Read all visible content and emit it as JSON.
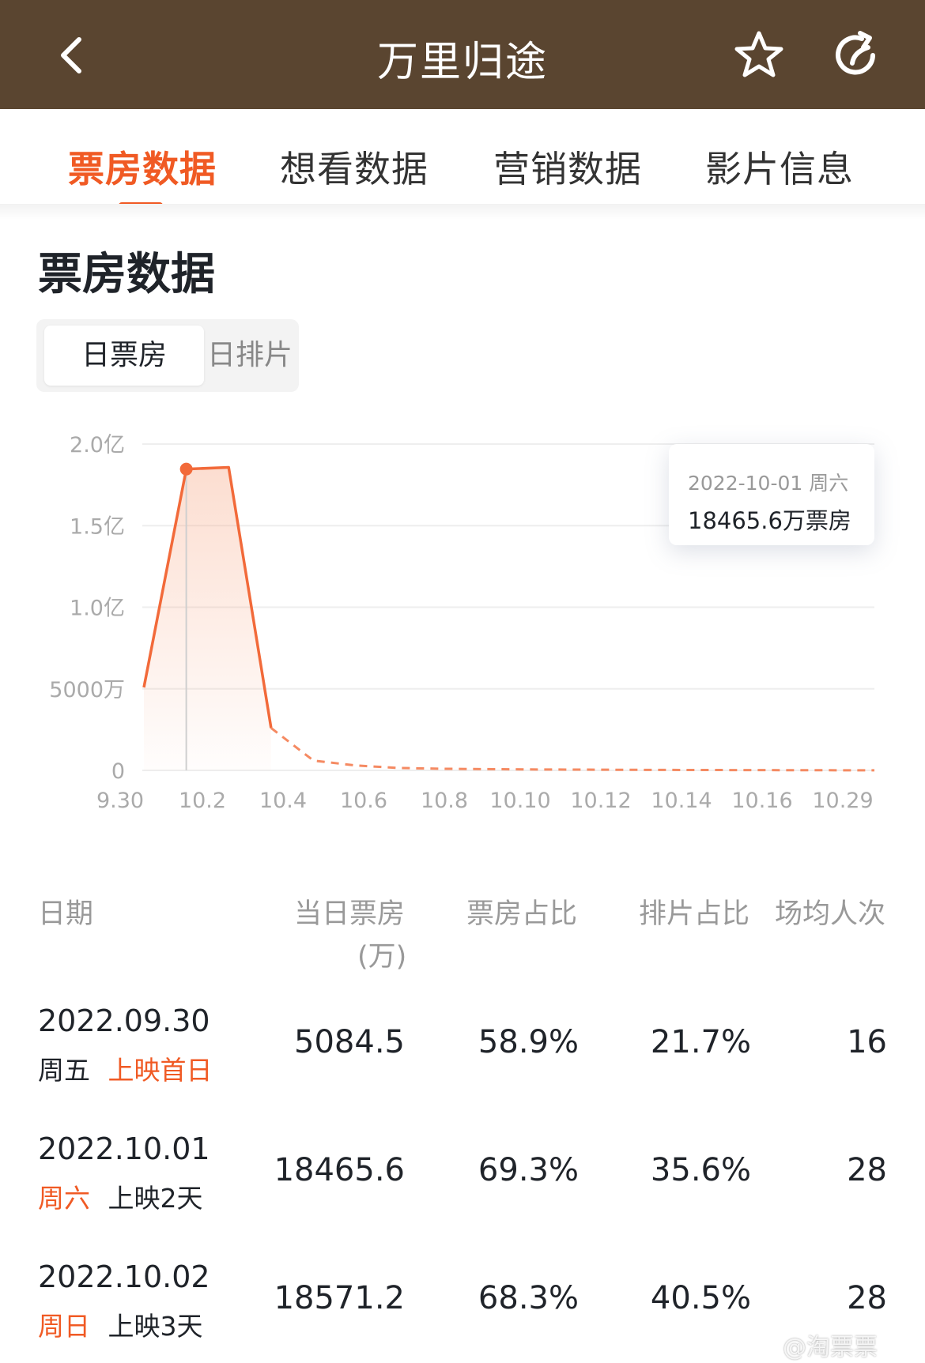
{
  "header": {
    "title": "万里归途",
    "back_icon": "back-icon",
    "favorite_icon": "star-icon",
    "share_icon": "share-icon",
    "color": "#5a4530"
  },
  "tabs": [
    {
      "label": "票房数据",
      "active": true
    },
    {
      "label": "想看数据",
      "active": false
    },
    {
      "label": "营销数据",
      "active": false
    },
    {
      "label": "影片信息",
      "active": false
    }
  ],
  "accent": "#f05a24",
  "section": {
    "title": "票房数据",
    "segments": [
      {
        "label": "日票房",
        "active": true
      },
      {
        "label": "日排片",
        "active": false
      }
    ]
  },
  "chart_data": {
    "type": "area",
    "y_tick_labels": [
      "2.0亿",
      "1.5亿",
      "1.0亿",
      "5000万",
      "0"
    ],
    "ylim": [
      0,
      20000
    ],
    "y_unit": "万",
    "x_tick_labels": [
      "9.30",
      "10.2",
      "10.4",
      "10.6",
      "10.8",
      "10.10",
      "10.12",
      "10.14",
      "10.16",
      "10.29"
    ],
    "x": [
      "9.30",
      "10.1",
      "10.2",
      "10.3",
      "10.4",
      "10.5",
      "10.6",
      "10.7",
      "10.8",
      "10.9",
      "10.10",
      "10.11",
      "10.12",
      "10.13",
      "10.14",
      "10.15",
      "10.16",
      "10.29"
    ],
    "values": [
      5084.5,
      18465.6,
      18571.2,
      2600,
      600,
      300,
      150,
      100,
      80,
      60,
      50,
      40,
      30,
      25,
      20,
      15,
      10,
      5
    ],
    "solid_until_index": 3,
    "highlight_index": 1,
    "tooltip": {
      "date": "2022-10-01  周六",
      "value": "18465.6万票房"
    }
  },
  "table": {
    "headers": [
      "日期",
      "当日票房",
      "(万)",
      "票房占比",
      "排片占比",
      "场均人次"
    ],
    "rows": [
      {
        "date": "2022.09.30",
        "weekday": "周五",
        "weekday_hl": false,
        "tag": "上映首日",
        "tag_hl": true,
        "box": "5084.5",
        "share": "58.9%",
        "screen": "21.7%",
        "avg": "16"
      },
      {
        "date": "2022.10.01",
        "weekday": "周六",
        "weekday_hl": true,
        "tag": "上映2天",
        "tag_hl": false,
        "box": "18465.6",
        "share": "69.3%",
        "screen": "35.6%",
        "avg": "28"
      },
      {
        "date": "2022.10.02",
        "weekday": "周日",
        "weekday_hl": true,
        "tag": "上映3天",
        "tag_hl": false,
        "box": "18571.2",
        "share": "68.3%",
        "screen": "40.5%",
        "avg": "28"
      }
    ]
  },
  "watermark": "@淘票票"
}
